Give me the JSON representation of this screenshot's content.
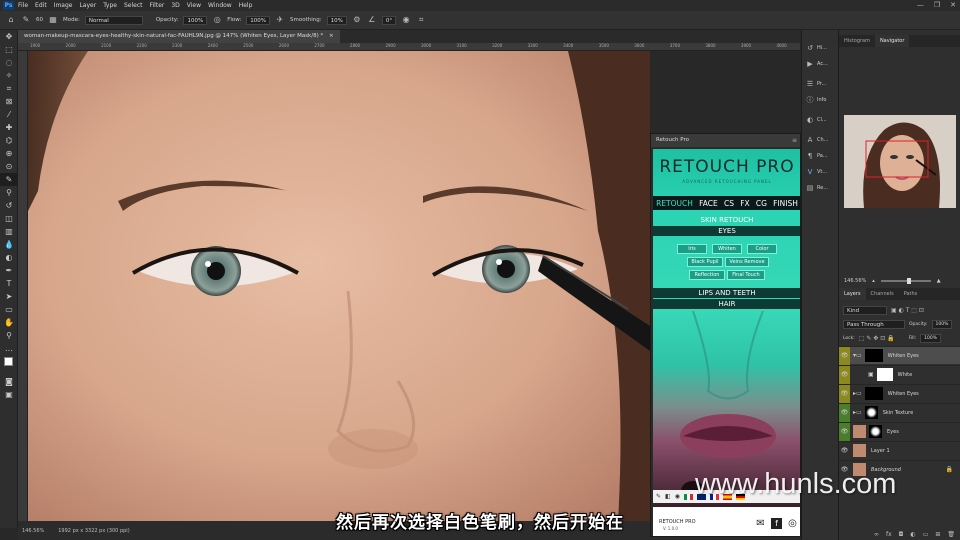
{
  "menubar": {
    "logo": "Ps",
    "items": [
      "File",
      "Edit",
      "Image",
      "Layer",
      "Type",
      "Select",
      "Filter",
      "3D",
      "View",
      "Window",
      "Help"
    ],
    "window_controls": [
      "—",
      "❐",
      "✕"
    ]
  },
  "options_bar": {
    "brush_size": "60",
    "mode_label": "Mode:",
    "mode_value": "Normal",
    "opacity_label": "Opacity:",
    "opacity_value": "100%",
    "flow_label": "Flow:",
    "flow_value": "100%",
    "smoothing_label": "Smoothing:",
    "smoothing_value": "10%",
    "angle_value": "0°"
  },
  "document": {
    "tab_title": "woman-makeup-mascara-eyes-healthy-skin-natural-fac-FAUHL9N.jpg @ 147% (Whiten Eyes, Layer Mask/8) *",
    "ruler_marks": [
      "1900",
      "2000",
      "2100",
      "2200",
      "2300",
      "2400",
      "2500",
      "2600",
      "2700",
      "2800",
      "2900",
      "3000",
      "3100",
      "3200",
      "3300",
      "3400",
      "3500",
      "3600",
      "3700",
      "3800",
      "3900",
      "4000"
    ]
  },
  "status_bar": {
    "zoom": "146.56%",
    "doc_info": "1992 px x 3322 px (300 ppi)"
  },
  "subtitle": "然后再次选择白色笔刷，然后开始在",
  "watermark": "www.hunls.com",
  "retouch_panel": {
    "title": "Retouch Pro",
    "logo": "RETOUCH PRO",
    "tagline": "ADVANCED RETOUCHING PANEL",
    "nav": [
      "RETOUCH",
      "FACE",
      "CS",
      "FX",
      "CG",
      "FINISH"
    ],
    "section_skin": "SKIN RETOUCH",
    "section_eyes": "EYES",
    "eye_buttons": [
      "Iris",
      "Whiten",
      "Color",
      "Black Pupil",
      "Veins Remove",
      "Reflection",
      "Final Touch"
    ],
    "section_lips": "LIPS AND TEETH",
    "section_hair": "HAIR",
    "footer_brand": "RETOUCH PRO",
    "footer_version": "V. 1.0.0"
  },
  "mini_panels": [
    {
      "icon": "history-icon",
      "label": "Hi..."
    },
    {
      "icon": "actions-icon",
      "label": "Ac..."
    },
    {
      "icon": "properties-icon",
      "label": "Pr..."
    },
    {
      "icon": "info-icon",
      "label": "Info"
    },
    {
      "icon": "color-icon",
      "label": "Cl..."
    },
    {
      "icon": "character-icon",
      "label": "Ch..."
    },
    {
      "icon": "paragraph-icon",
      "label": "Pa..."
    },
    {
      "icon": "vt-icon",
      "label": "Vt..."
    },
    {
      "icon": "retouch-icon",
      "label": "Re..."
    }
  ],
  "right_panels": {
    "top_tabs": [
      "Histogram",
      "Navigator"
    ],
    "nav_zoom": "146.56%",
    "layer_tabs": [
      "Layers",
      "Channels",
      "Paths"
    ],
    "kind_label": "Kind",
    "blend_mode": "Pass Through",
    "opacity_label": "Opacity:",
    "opacity_value": "100%",
    "lock_label": "Lock:",
    "fill_label": "Fill:",
    "fill_value": "100%",
    "layers": [
      {
        "name": "Whiten Eyes",
        "color_tag": "yellow",
        "selected": true
      },
      {
        "name": "White",
        "color_tag": "yellow",
        "selected": false
      },
      {
        "name": "Whiten Eyes",
        "color_tag": "yellow",
        "selected": false
      },
      {
        "name": "Skin Texture",
        "color_tag": "green",
        "selected": false
      },
      {
        "name": "Eyes",
        "color_tag": "green",
        "selected": false
      },
      {
        "name": "Layer 1",
        "color_tag": "none",
        "selected": false
      },
      {
        "name": "Background",
        "color_tag": "none",
        "selected": false
      }
    ]
  },
  "colors": {
    "accent_teal": "#2bd4b4",
    "layer_yellow": "#8c8a1f",
    "layer_green": "#4a7d2c"
  }
}
